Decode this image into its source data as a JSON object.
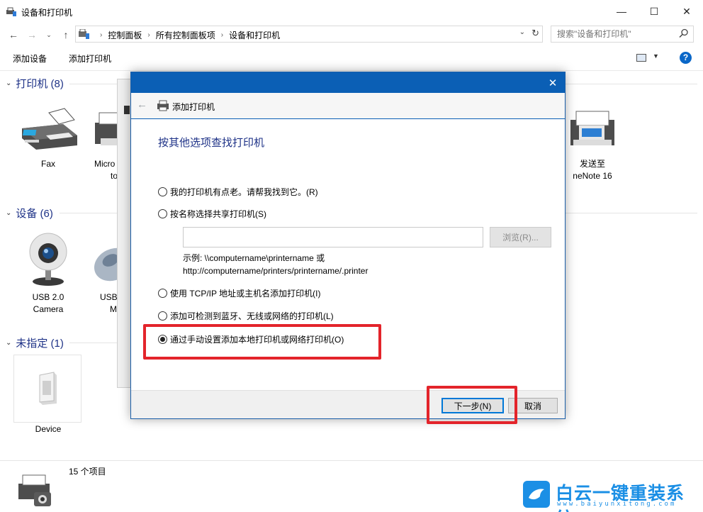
{
  "window": {
    "title": "设备和打印机",
    "minimize": "—",
    "maximize": "☐",
    "close": "✕"
  },
  "address": {
    "crumbs": [
      "控制面板",
      "所有控制面板项",
      "设备和打印机"
    ],
    "search_placeholder": "搜索\"设备和打印机\""
  },
  "toolbar": {
    "add_device": "添加设备",
    "add_printer": "添加打印机",
    "help": "?"
  },
  "groups": {
    "printers": {
      "header": "打印机 (8)",
      "items": [
        {
          "label": "Fax",
          "icon": "fax-icon"
        },
        {
          "label": "Micro",
          "label2": "to",
          "icon": "printer-icon"
        },
        {
          "label": "发送至",
          "label2": "neNote 16",
          "icon": "onenote-printer-icon"
        }
      ]
    },
    "devices": {
      "header": "设备 (6)",
      "items": [
        {
          "label": "USB 2.0",
          "label2": "Camera",
          "icon": "webcam-icon"
        },
        {
          "label": "USB",
          "label2": "M",
          "icon": "mouse-icon"
        }
      ]
    },
    "unspecified": {
      "header": "未指定 (1)",
      "items": [
        {
          "label": "Device",
          "icon": "device-tower-icon"
        }
      ]
    }
  },
  "status": {
    "count": "15 个项目"
  },
  "dialog": {
    "title": "添加打印机",
    "heading": "按其他选项查找打印机",
    "options": [
      {
        "label": "我的打印机有点老。请帮我找到它。(R)",
        "checked": false
      },
      {
        "label": "按名称选择共享打印机(S)",
        "checked": false
      },
      {
        "label": "使用 TCP/IP 地址或主机名添加打印机(I)",
        "checked": false
      },
      {
        "label": "添加可检测到蓝牙、无线或网络的打印机(L)",
        "checked": false
      },
      {
        "label": "通过手动设置添加本地打印机或网络打印机(O)",
        "checked": true
      }
    ],
    "browse": "浏览(R)...",
    "example_line1": "示例: \\\\computername\\printername 或",
    "example_line2": "http://computername/printers/printername/.printer",
    "next": "下一步(N)",
    "cancel": "取消",
    "close": "✕",
    "back": "←"
  },
  "watermark": {
    "brand": "白云一键重装系统",
    "url": "www.baiyunxitong.com"
  },
  "colors": {
    "dialog_header": "#0b5fb5",
    "heading_blue": "#1e3287",
    "callout_red": "#e3242b"
  }
}
